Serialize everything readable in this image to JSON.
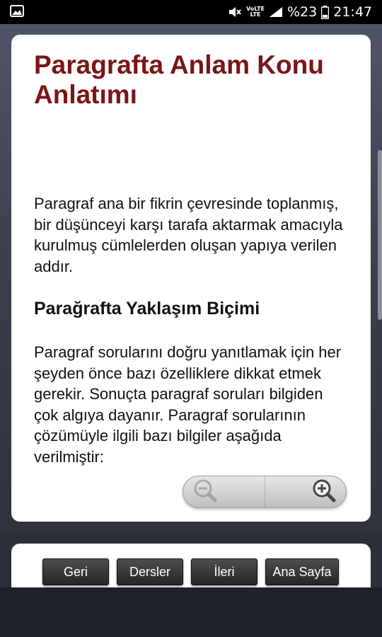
{
  "status_bar": {
    "battery": "%23",
    "time": "21:47",
    "network_top": "VoLTE",
    "network_bottom": "LTE",
    "icons": [
      "image-icon",
      "mute-icon",
      "volte-icon",
      "signal-icon",
      "battery-icon"
    ]
  },
  "page": {
    "title": "Paragrafta Anlam Konu Anlatımı",
    "intro": "Paragraf ana bir fikrin çevresinde toplanmış, bir düşünceyi karşı tarafa aktarmak amacıyla kurulmuş cümlelerden oluşan yapıya verilen addır.",
    "section_heading": "Parağrafta Yaklaşım Biçimi",
    "section_text": "Paragraf sorularını doğru yanıtlamak için her şeyden önce bazı özelliklere dikkat etmek gerekir. Sonuçta paragraf soruları bilgiden çok algıya dayanır. Paragraf sorularının çözümüyle ilgili bazı bilgiler aşağıda verilmiştir:"
  },
  "zoom": {
    "out_icon": "zoom-out-icon",
    "in_icon": "zoom-in-icon"
  },
  "nav": {
    "back_label": "Geri",
    "lessons_label": "Dersler",
    "forward_label": "İleri",
    "home_label": "Ana Sayfa"
  },
  "colors": {
    "title": "#7a1616",
    "background": "#3a3f4d",
    "button": "#333333"
  }
}
